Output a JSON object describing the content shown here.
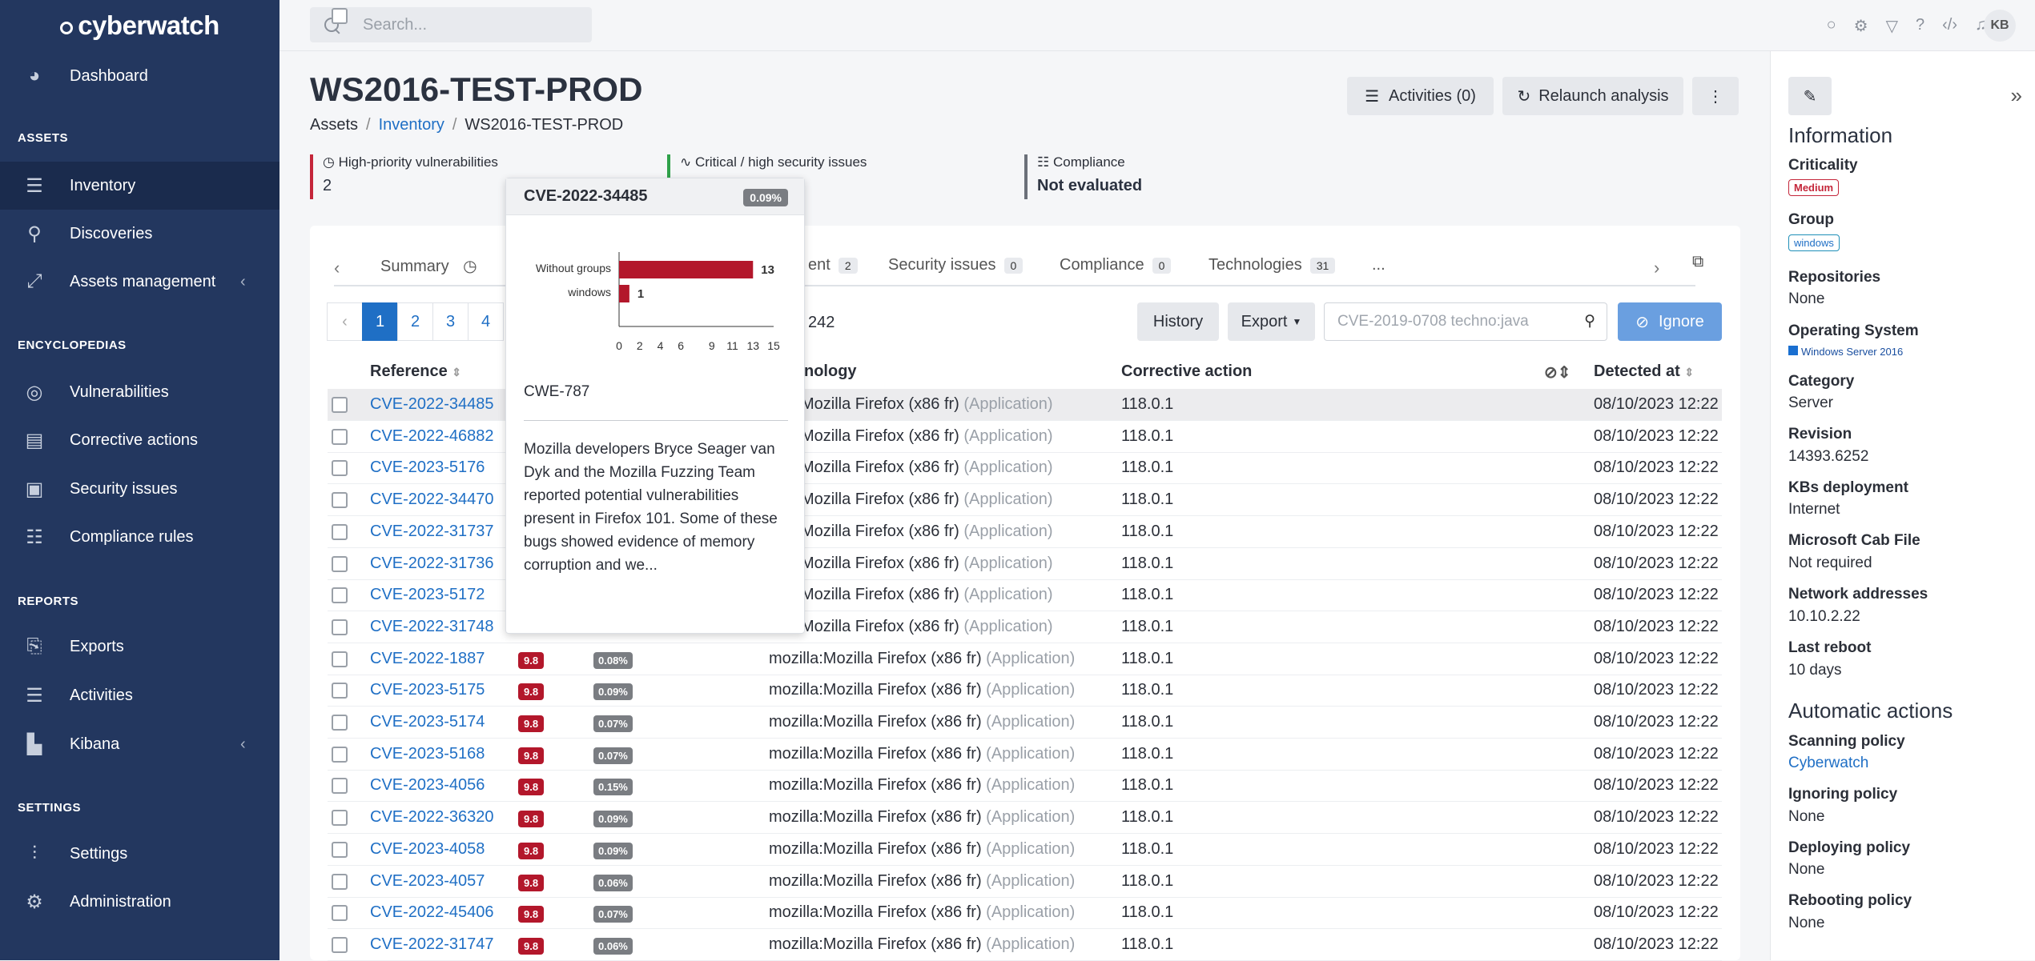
{
  "app": {
    "logo": "cyberwatch"
  },
  "search": {
    "placeholder": "Search..."
  },
  "user": {
    "initials": "KB"
  },
  "sidebar": {
    "dashboard": "Dashboard",
    "sections": {
      "assets": "ASSETS",
      "encyclopedias": "ENCYCLOPEDIAS",
      "reports": "REPORTS",
      "settings": "SETTINGS"
    },
    "inventory": "Inventory",
    "discoveries": "Discoveries",
    "assets_management": "Assets management",
    "vulnerabilities": "Vulnerabilities",
    "corrective_actions": "Corrective actions",
    "security_issues": "Security issues",
    "compliance_rules": "Compliance rules",
    "exports": "Exports",
    "activities": "Activities",
    "kibana": "Kibana",
    "settings": "Settings",
    "administration": "Administration"
  },
  "page": {
    "title": "WS2016-TEST-PROD",
    "breadcrumb": [
      "Assets",
      "Inventory",
      "WS2016-TEST-PROD"
    ],
    "activities_btn": "Activities (0)",
    "relaunch_btn": "Relaunch analysis"
  },
  "stats": {
    "high_priority_label": "High-priority vulnerabilities",
    "high_priority_value": "2",
    "critical_label": "Critical / high security issues",
    "compliance_label": "Compliance",
    "compliance_value": "Not evaluated"
  },
  "tabs": {
    "summary": "Summary",
    "deployment_partial": "ent",
    "deployment_count": "2",
    "security_issues": "Security issues",
    "security_issues_count": "0",
    "compliance": "Compliance",
    "compliance_count": "0",
    "technologies": "Technologies",
    "technologies_count": "31",
    "more": "..."
  },
  "toolbar": {
    "pages": [
      "‹",
      "1",
      "2",
      "3",
      "4"
    ],
    "total": "242",
    "history": "History",
    "export": "Export",
    "filter_placeholder": "CVE-2019-0708 techno:java",
    "ignore": "Ignore"
  },
  "table": {
    "col_reference": "Reference",
    "col_technology": "nology",
    "col_corrective": "Corrective action",
    "col_detected": "Detected at",
    "rows": [
      {
        "ref": "CVE-2022-34485",
        "sev": "",
        "epss": "",
        "tech": "zilla:Mozilla Firefox (x86 fr)",
        "kind": "(Application)",
        "fix": "118.0.1",
        "date": "08/10/2023 12:22"
      },
      {
        "ref": "CVE-2022-46882",
        "sev": "",
        "epss": "",
        "tech": "zilla:Mozilla Firefox (x86 fr)",
        "kind": "(Application)",
        "fix": "118.0.1",
        "date": "08/10/2023 12:22"
      },
      {
        "ref": "CVE-2023-5176",
        "sev": "",
        "epss": "",
        "tech": "zilla:Mozilla Firefox (x86 fr)",
        "kind": "(Application)",
        "fix": "118.0.1",
        "date": "08/10/2023 12:22"
      },
      {
        "ref": "CVE-2022-34470",
        "sev": "",
        "epss": "",
        "tech": "zilla:Mozilla Firefox (x86 fr)",
        "kind": "(Application)",
        "fix": "118.0.1",
        "date": "08/10/2023 12:22"
      },
      {
        "ref": "CVE-2022-31737",
        "sev": "",
        "epss": "",
        "tech": "zilla:Mozilla Firefox (x86 fr)",
        "kind": "(Application)",
        "fix": "118.0.1",
        "date": "08/10/2023 12:22"
      },
      {
        "ref": "CVE-2022-31736",
        "sev": "",
        "epss": "",
        "tech": "zilla:Mozilla Firefox (x86 fr)",
        "kind": "(Application)",
        "fix": "118.0.1",
        "date": "08/10/2023 12:22"
      },
      {
        "ref": "CVE-2023-5172",
        "sev": "",
        "epss": "",
        "tech": "zilla:Mozilla Firefox (x86 fr)",
        "kind": "(Application)",
        "fix": "118.0.1",
        "date": "08/10/2023 12:22"
      },
      {
        "ref": "CVE-2022-31748",
        "sev": "",
        "epss": "",
        "tech": "zilla:Mozilla Firefox (x86 fr)",
        "kind": "(Application)",
        "fix": "118.0.1",
        "date": "08/10/2023 12:22"
      },
      {
        "ref": "CVE-2022-1887",
        "sev": "9.8",
        "epss": "0.08%",
        "tech": "mozilla:Mozilla Firefox (x86 fr)",
        "kind": "(Application)",
        "fix": "118.0.1",
        "date": "08/10/2023 12:22"
      },
      {
        "ref": "CVE-2023-5175",
        "sev": "9.8",
        "epss": "0.09%",
        "tech": "mozilla:Mozilla Firefox (x86 fr)",
        "kind": "(Application)",
        "fix": "118.0.1",
        "date": "08/10/2023 12:22"
      },
      {
        "ref": "CVE-2023-5174",
        "sev": "9.8",
        "epss": "0.07%",
        "tech": "mozilla:Mozilla Firefox (x86 fr)",
        "kind": "(Application)",
        "fix": "118.0.1",
        "date": "08/10/2023 12:22"
      },
      {
        "ref": "CVE-2023-5168",
        "sev": "9.8",
        "epss": "0.07%",
        "tech": "mozilla:Mozilla Firefox (x86 fr)",
        "kind": "(Application)",
        "fix": "118.0.1",
        "date": "08/10/2023 12:22"
      },
      {
        "ref": "CVE-2023-4056",
        "sev": "9.8",
        "epss": "0.15%",
        "tech": "mozilla:Mozilla Firefox (x86 fr)",
        "kind": "(Application)",
        "fix": "118.0.1",
        "date": "08/10/2023 12:22"
      },
      {
        "ref": "CVE-2022-36320",
        "sev": "9.8",
        "epss": "0.09%",
        "tech": "mozilla:Mozilla Firefox (x86 fr)",
        "kind": "(Application)",
        "fix": "118.0.1",
        "date": "08/10/2023 12:22"
      },
      {
        "ref": "CVE-2023-4058",
        "sev": "9.8",
        "epss": "0.09%",
        "tech": "mozilla:Mozilla Firefox (x86 fr)",
        "kind": "(Application)",
        "fix": "118.0.1",
        "date": "08/10/2023 12:22"
      },
      {
        "ref": "CVE-2023-4057",
        "sev": "9.8",
        "epss": "0.06%",
        "tech": "mozilla:Mozilla Firefox (x86 fr)",
        "kind": "(Application)",
        "fix": "118.0.1",
        "date": "08/10/2023 12:22"
      },
      {
        "ref": "CVE-2022-45406",
        "sev": "9.8",
        "epss": "0.07%",
        "tech": "mozilla:Mozilla Firefox (x86 fr)",
        "kind": "(Application)",
        "fix": "118.0.1",
        "date": "08/10/2023 12:22"
      },
      {
        "ref": "CVE-2022-31747",
        "sev": "9.8",
        "epss": "0.06%",
        "tech": "mozilla:Mozilla Firefox (x86 fr)",
        "kind": "(Application)",
        "fix": "118.0.1",
        "date": "08/10/2023 12:22"
      }
    ]
  },
  "popup": {
    "cve": "CVE-2022-34485",
    "epss": "0.09%",
    "cwe": "CWE-787",
    "description": "Mozilla developers Bryce Seager van Dyk and the Mozilla Fuzzing Team reported potential vulnerabilities present in Firefox 101. Some of these bugs showed evidence of memory corruption and we..."
  },
  "chart_data": {
    "type": "bar",
    "orientation": "horizontal",
    "categories": [
      "Without groups",
      "windows"
    ],
    "values": [
      13,
      1
    ],
    "xticks": [
      0,
      2,
      4,
      6,
      9,
      11,
      13,
      15
    ],
    "xlim": [
      0,
      15
    ],
    "color": "#b3172b"
  },
  "info": {
    "heading": "Information",
    "criticality_label": "Criticality",
    "criticality_value": "Medium",
    "group_label": "Group",
    "group_value": "windows",
    "repositories_label": "Repositories",
    "repositories_value": "None",
    "os_label": "Operating System",
    "os_value": "Windows Server 2016",
    "category_label": "Category",
    "category_value": "Server",
    "revision_label": "Revision",
    "revision_value": "14393.6252",
    "kbs_label": "KBs deployment",
    "kbs_value": "Internet",
    "cab_label": "Microsoft Cab File",
    "cab_value": "Not required",
    "net_label": "Network addresses",
    "net_value": "10.10.2.22",
    "reboot_label": "Last reboot",
    "reboot_value": "10 days",
    "auto_heading": "Automatic actions",
    "scan_label": "Scanning policy",
    "scan_value": "Cyberwatch",
    "ignore_label": "Ignoring policy",
    "ignore_value": "None",
    "deploy_label": "Deploying policy",
    "deploy_value": "None",
    "rebooting_label": "Rebooting policy",
    "rebooting_value": "None"
  }
}
